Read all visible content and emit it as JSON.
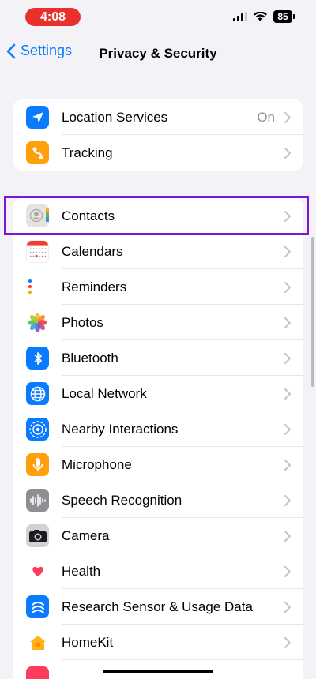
{
  "status_bar": {
    "time": "4:08",
    "battery": "85"
  },
  "nav": {
    "back_label": "Settings",
    "title": "Privacy & Security"
  },
  "group_1": [
    {
      "label": "Location Services",
      "value": "On",
      "icon": "location-arrow-icon",
      "color": "#0a7aff"
    },
    {
      "label": "Tracking",
      "icon": "tracking-icon",
      "color": "#ff9f0a"
    }
  ],
  "group_2": [
    {
      "label": "Contacts",
      "icon": "contacts-icon"
    },
    {
      "label": "Calendars",
      "icon": "calendar-icon"
    },
    {
      "label": "Reminders",
      "icon": "reminders-icon"
    },
    {
      "label": "Photos",
      "icon": "photos-icon"
    },
    {
      "label": "Bluetooth",
      "icon": "bluetooth-icon",
      "color": "#0a7aff"
    },
    {
      "label": "Local Network",
      "icon": "globe-icon",
      "color": "#0a7aff"
    },
    {
      "label": "Nearby Interactions",
      "icon": "nearby-icon",
      "color": "#0a7aff"
    },
    {
      "label": "Microphone",
      "icon": "microphone-icon",
      "color": "#ff9f0a"
    },
    {
      "label": "Speech Recognition",
      "icon": "waveform-icon",
      "color": "#8e8e93"
    },
    {
      "label": "Camera",
      "icon": "camera-icon",
      "color": "#8e8e93"
    },
    {
      "label": "Health",
      "icon": "heart-icon"
    },
    {
      "label": "Research Sensor & Usage Data",
      "icon": "research-icon",
      "color": "#0a7aff"
    },
    {
      "label": "HomeKit",
      "icon": "home-icon"
    }
  ]
}
